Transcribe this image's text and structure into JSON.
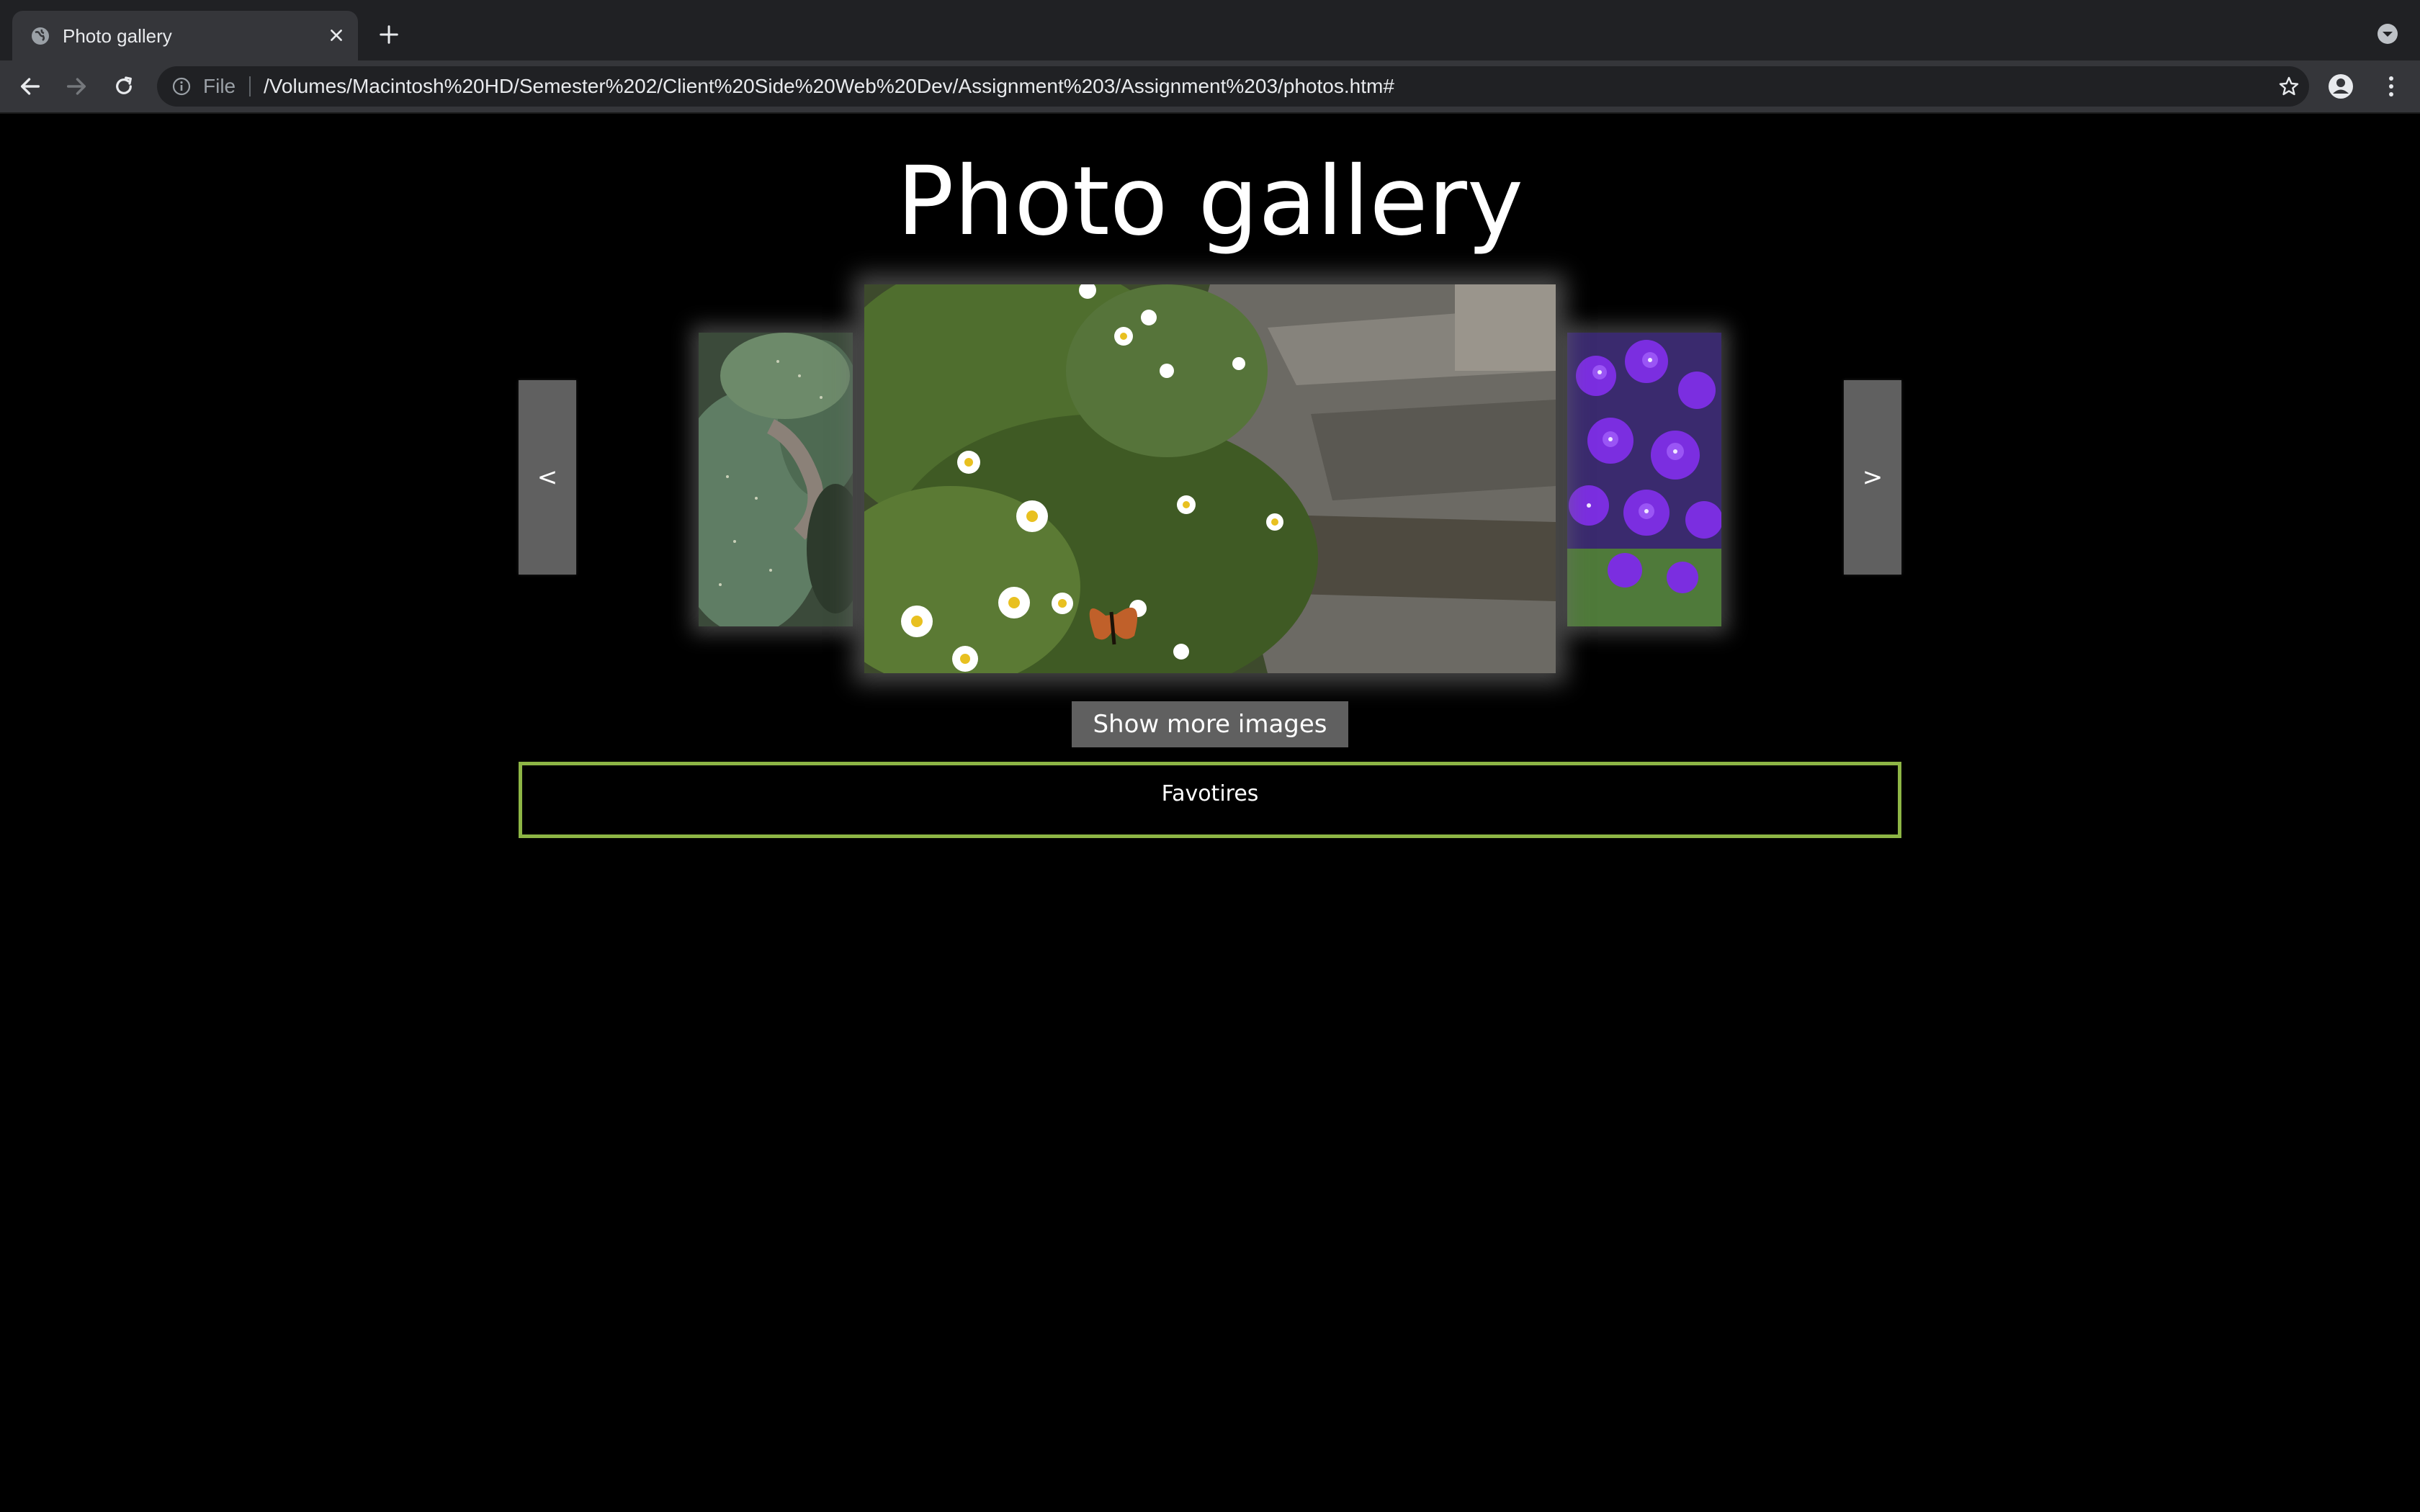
{
  "browser": {
    "tab_title": "Photo gallery",
    "new_tab_symbol": "+",
    "scheme_label": "File",
    "url": "/Volumes/Macintosh%20HD/Semester%202/Client%20Side%20Web%20Dev/Assignment%203/Assignment%203/photos.htm#",
    "icons": [
      "globe-icon",
      "close-icon",
      "plus-icon",
      "back-icon",
      "forward-icon",
      "reload-icon",
      "info-icon",
      "star-icon",
      "profile-icon",
      "menu-icon",
      "tab-search-icon"
    ]
  },
  "gallery": {
    "title": "Photo gallery",
    "prev_label": "<",
    "next_label": ">",
    "slides": [
      {
        "position": "left",
        "subject": "cactus"
      },
      {
        "position": "center",
        "subject": "daisies-and-butterfly"
      },
      {
        "position": "right",
        "subject": "purple-flowers"
      }
    ],
    "more_button": "Show more images"
  },
  "favorites": {
    "label": "Favotires"
  },
  "colors": {
    "page_bg": "#000000",
    "button_bg": "#606060",
    "favorites_border": "#8db545",
    "chrome_dark": "#202124",
    "chrome_toolbar": "#35363a"
  }
}
